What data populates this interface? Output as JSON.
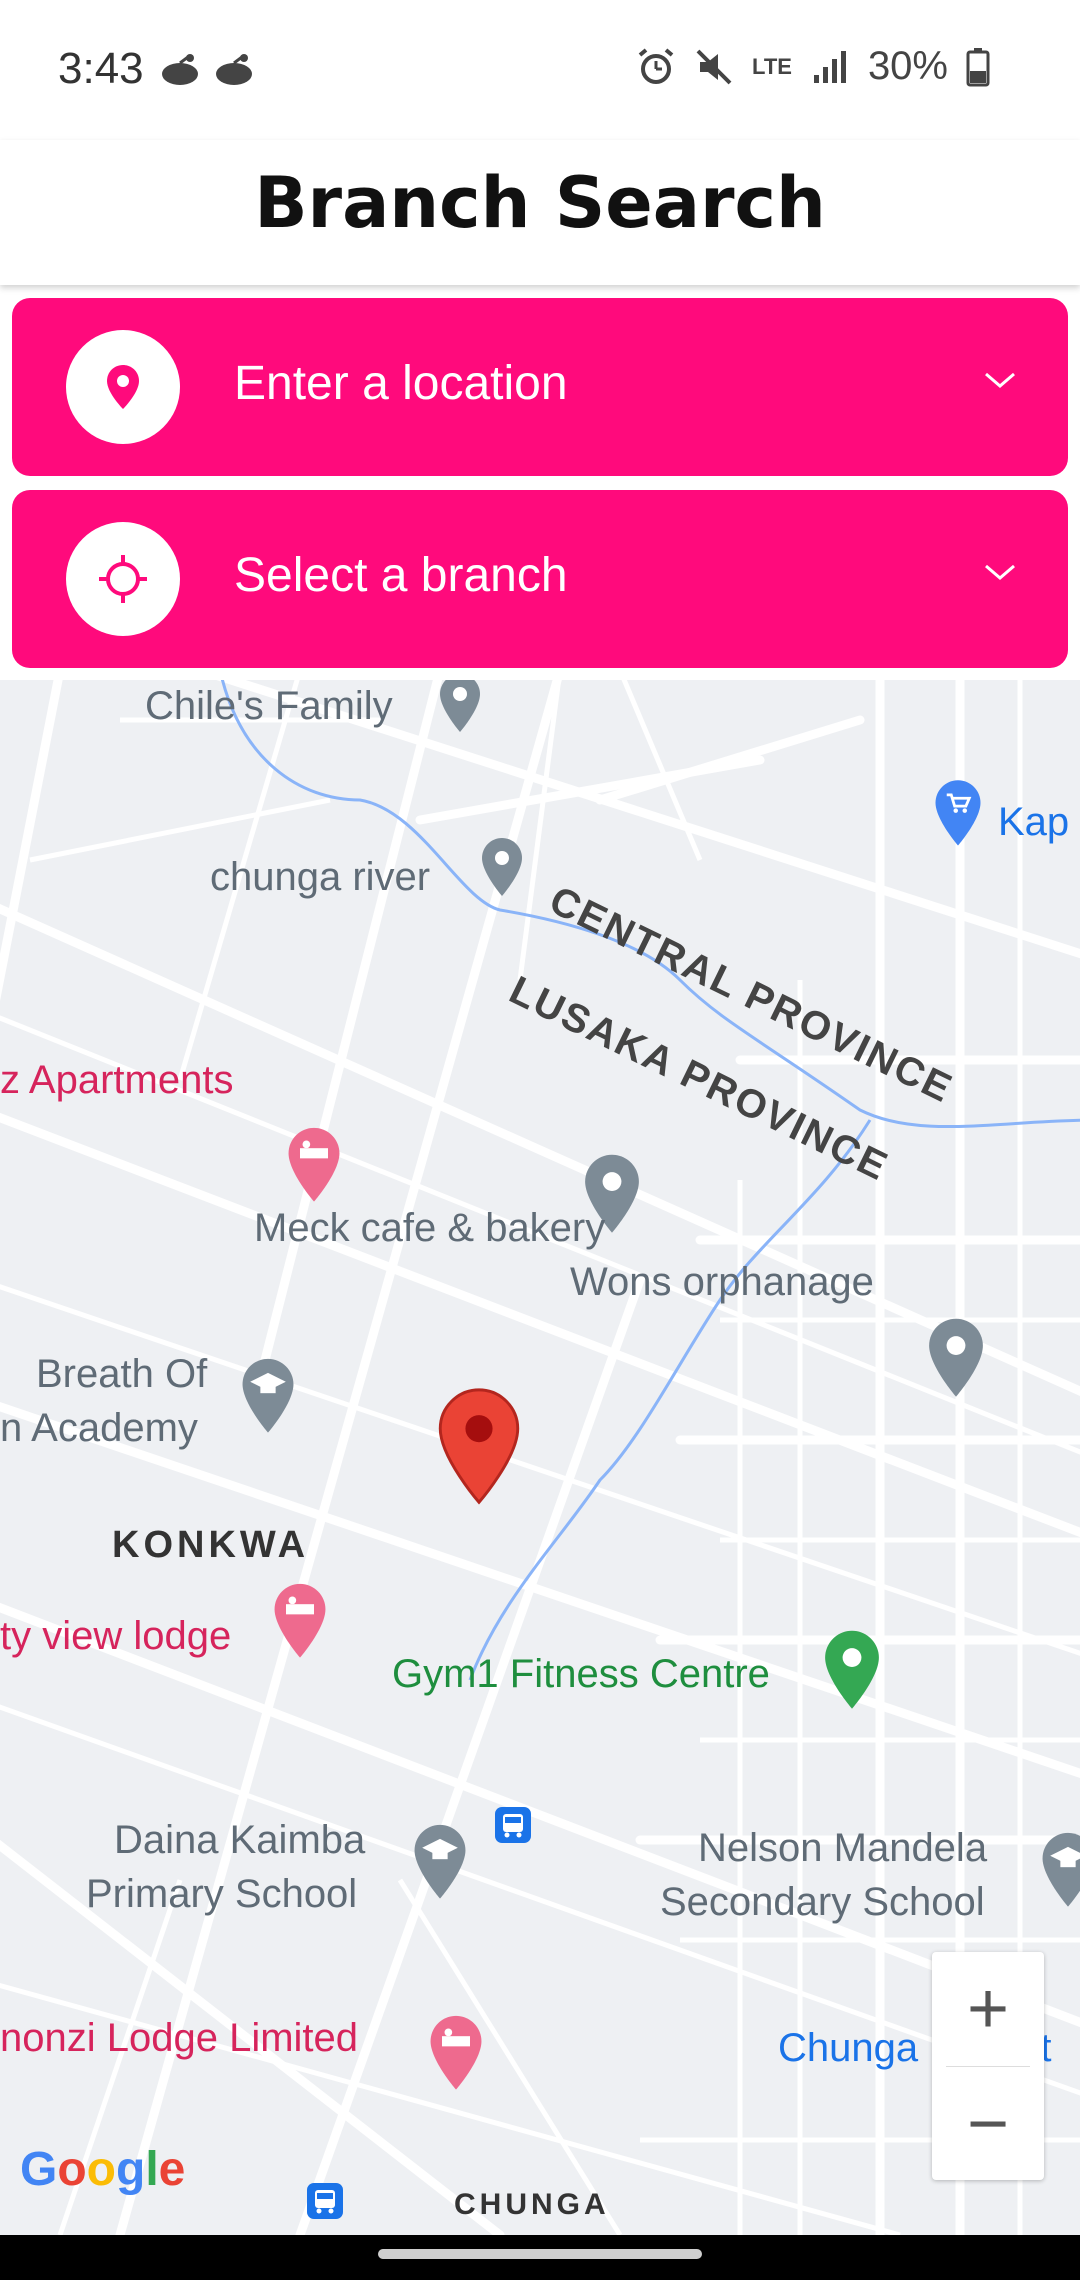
{
  "status_bar": {
    "time": "3:43",
    "network": "LTE",
    "battery": "30%"
  },
  "header": {
    "title": "Branch Search"
  },
  "location_select": {
    "placeholder": "Enter a location"
  },
  "branch_select": {
    "placeholder": "Select a branch"
  },
  "map": {
    "places": {
      "chiles_family": "Chile's Family",
      "chunga_river": "chunga river",
      "kap": "Kap",
      "central_province": "CENTRAL PROVINCE",
      "lusaka_province": "LUSAKA PROVINCE",
      "apartments": "z Apartments",
      "meck_cafe": "Meck cafe & bakery",
      "wons_orphanage": "Wons orphanage",
      "breath_of_1": "Breath Of",
      "breath_of_2": "n Academy",
      "konkwa": "KONKWA",
      "view_lodge": "ty view lodge",
      "gym": "Gym1 Fitness Centre",
      "daina_1": "Daina Kaimba",
      "daina_2": "Primary School",
      "nelson_1": "Nelson Mandela",
      "nelson_2": "Secondary School",
      "nonzi": "nonzi Lodge Limited",
      "chunga_market": "Chunga Market",
      "chunga": "CHUNGA"
    },
    "zoom_in": "+",
    "zoom_out": "−",
    "attribution": "Google"
  },
  "colors": {
    "accent": "#ff0a7c",
    "marker": "#ea4335"
  }
}
